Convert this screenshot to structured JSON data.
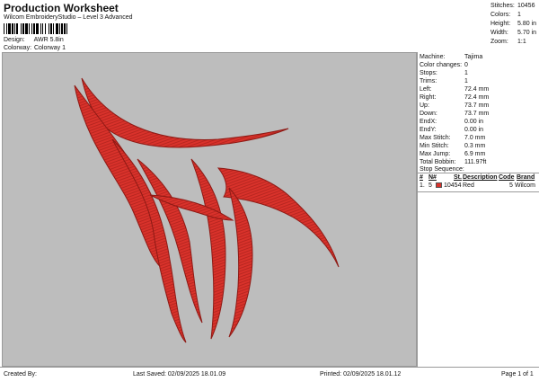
{
  "header": {
    "title": "Production Worksheet",
    "subtitle": "Wilcom EmbroideryStudio – Level 3 Advanced",
    "design_label": "Design:",
    "design_value": "AWR 5.8in",
    "colorway_label": "Colorway:",
    "colorway_value": "Colorway 1"
  },
  "stats": [
    {
      "label": "Stitches:",
      "value": "10456"
    },
    {
      "label": "Colors:",
      "value": "1"
    },
    {
      "label": "Height:",
      "value": "5.80 in"
    },
    {
      "label": "Width:",
      "value": "5.70 in"
    },
    {
      "label": "Zoom:",
      "value": "1:1"
    }
  ],
  "machine_info": [
    {
      "label": "Machine:",
      "value": "Tajima"
    },
    {
      "label": "Color changes:",
      "value": "0"
    },
    {
      "label": "Stops:",
      "value": "1"
    },
    {
      "label": "Trims:",
      "value": "1"
    },
    {
      "label": "Left:",
      "value": "72.4 mm"
    },
    {
      "label": "Right:",
      "value": "72.4 mm"
    },
    {
      "label": "Up:",
      "value": "73.7 mm"
    },
    {
      "label": "Down:",
      "value": "73.7 mm"
    },
    {
      "label": "EndX:",
      "value": "0.00 in"
    },
    {
      "label": "EndY:",
      "value": "0.00 in"
    },
    {
      "label": "Max Stitch:",
      "value": "7.0 mm"
    },
    {
      "label": "Min Stitch:",
      "value": "0.3 mm"
    },
    {
      "label": "Max Jump:",
      "value": "6.9 mm"
    },
    {
      "label": "Total Bobbin:",
      "value": "111.97ft"
    }
  ],
  "stop_sequence": {
    "title": "Stop Sequence:",
    "headers": {
      "num": "#",
      "n": "N#",
      "st": "St.",
      "description": "Description",
      "code": "Code",
      "brand": "Brand"
    },
    "rows": [
      {
        "num": "1.",
        "n": "5",
        "color": "#d9322b",
        "st": "10454",
        "description": "Red",
        "code": "5",
        "brand": "Wilcom"
      }
    ]
  },
  "footer": {
    "created_by": "Created By:",
    "last_saved": "Last Saved: 02/09/2025 18.01.09",
    "printed": "Printed: 02/09/2025 18.01.12",
    "page": "Page 1 of 1"
  },
  "colors": {
    "thread": "#d9322b",
    "thread_dark": "#a81e18",
    "thread_light": "#ef6a5f",
    "canvas": "#bdbdbd"
  }
}
